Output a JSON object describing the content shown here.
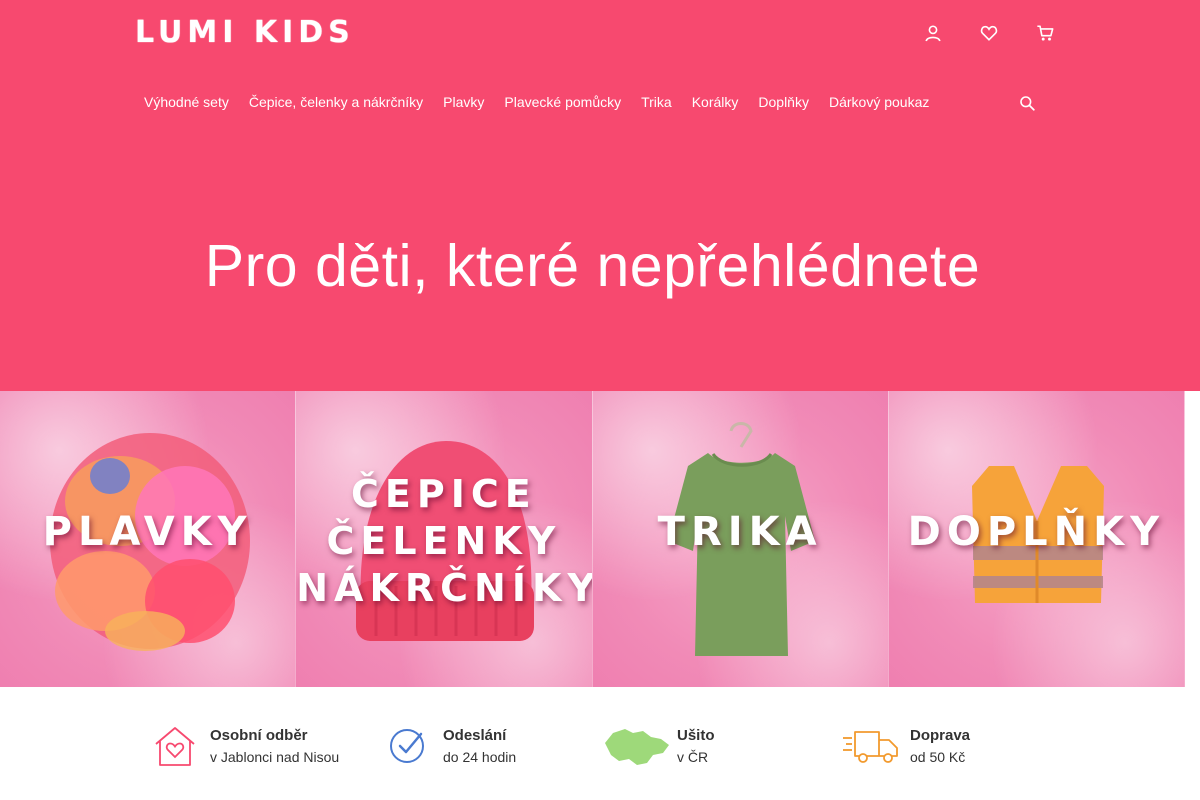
{
  "colors": {
    "brand": "#f7496f",
    "tile_pink": "#f18bb7",
    "text_dark": "#333333"
  },
  "header": {
    "logo": "LUMI KIDS",
    "top_icons": [
      "user-icon",
      "heart-icon",
      "cart-icon"
    ]
  },
  "nav": {
    "items": [
      "Výhodné sety",
      "Čepice, čelenky a nákrčníky",
      "Plavky",
      "Plavecké pomůcky",
      "Trika",
      "Korálky",
      "Doplňky",
      "Dárkový poukaz"
    ],
    "search_icon": "search-icon"
  },
  "hero": {
    "headline": "Pro děti, které nepřehlédnete"
  },
  "categories": [
    {
      "label_lines": [
        "PLAVKY"
      ],
      "icon": "swimsuits-image"
    },
    {
      "label_lines": [
        "ČEPICE",
        "ČELENKY",
        "NÁKRČNÍKY"
      ],
      "icon": "beanie-image"
    },
    {
      "label_lines": [
        "TRIKA"
      ],
      "icon": "tshirt-image"
    },
    {
      "label_lines": [
        "DOPLŇKY"
      ],
      "icon": "vest-image"
    }
  ],
  "benefits": [
    {
      "title": "Osobní odběr",
      "subtitle": "v Jablonci nad Nisou",
      "icon": "house-heart-icon"
    },
    {
      "title": "Odeslání",
      "subtitle": "do 24 hodin",
      "icon": "clock-check-icon"
    },
    {
      "title": "Ušito",
      "subtitle": "v ČR",
      "icon": "czech-map-icon"
    },
    {
      "title": "Doprava",
      "subtitle": "od 50 Kč",
      "icon": "delivery-truck-icon"
    }
  ]
}
